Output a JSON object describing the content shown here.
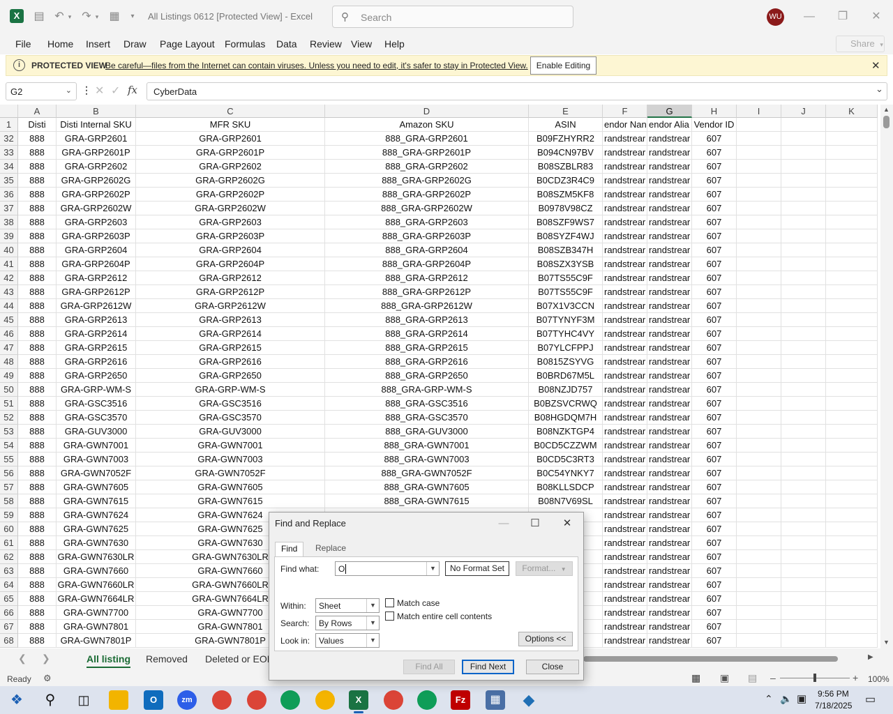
{
  "app": {
    "doc_title": "All Listings 0612  [Protected View]  -  Excel",
    "search_placeholder": "Search",
    "user_initials": "WU"
  },
  "ribbon": {
    "tabs": [
      "File",
      "Home",
      "Insert",
      "Draw",
      "Page Layout",
      "Formulas",
      "Data",
      "Review",
      "View",
      "Help"
    ],
    "share_label": "Share"
  },
  "protected_bar": {
    "title": "PROTECTED VIEW",
    "message": "Be careful—files from the Internet can contain viruses. Unless you need to edit, it's safer to stay in Protected View.",
    "enable_label": "Enable Editing"
  },
  "formula_bar": {
    "name_box": "G2",
    "fx_label": "fx",
    "value": "CyberData"
  },
  "sheet": {
    "columns": [
      "A",
      "B",
      "C",
      "D",
      "E",
      "F",
      "G",
      "H",
      "I",
      "J",
      "K"
    ],
    "selected_column": "G",
    "header_row": {
      "row": "1",
      "cells": [
        "Disti",
        "Disti Internal SKU",
        "MFR SKU",
        "Amazon SKU",
        "ASIN",
        "endor Nan",
        "endor Alia",
        "Vendor ID",
        "",
        "",
        ""
      ]
    },
    "rows": [
      [
        "32",
        "888",
        "GRA-GRP2601",
        "GRA-GRP2601",
        "888_GRA-GRP2601",
        "B09FZHYRR2",
        "randstrear",
        "randstrear",
        "607"
      ],
      [
        "33",
        "888",
        "GRA-GRP2601P",
        "GRA-GRP2601P",
        "888_GRA-GRP2601P",
        "B094CN97BV",
        "randstrear",
        "randstrear",
        "607"
      ],
      [
        "34",
        "888",
        "GRA-GRP2602",
        "GRA-GRP2602",
        "888_GRA-GRP2602",
        "B08SZBLR83",
        "randstrear",
        "randstrear",
        "607"
      ],
      [
        "35",
        "888",
        "GRA-GRP2602G",
        "GRA-GRP2602G",
        "888_GRA-GRP2602G",
        "B0CDZ3R4C9",
        "randstrear",
        "randstrear",
        "607"
      ],
      [
        "36",
        "888",
        "GRA-GRP2602P",
        "GRA-GRP2602P",
        "888_GRA-GRP2602P",
        "B08SZM5KF8",
        "randstrear",
        "randstrear",
        "607"
      ],
      [
        "37",
        "888",
        "GRA-GRP2602W",
        "GRA-GRP2602W",
        "888_GRA-GRP2602W",
        "B0978V98CZ",
        "randstrear",
        "randstrear",
        "607"
      ],
      [
        "38",
        "888",
        "GRA-GRP2603",
        "GRA-GRP2603",
        "888_GRA-GRP2603",
        "B08SZF9WS7",
        "randstrear",
        "randstrear",
        "607"
      ],
      [
        "39",
        "888",
        "GRA-GRP2603P",
        "GRA-GRP2603P",
        "888_GRA-GRP2603P",
        "B08SYZF4WJ",
        "randstrear",
        "randstrear",
        "607"
      ],
      [
        "40",
        "888",
        "GRA-GRP2604",
        "GRA-GRP2604",
        "888_GRA-GRP2604",
        "B08SZB347H",
        "randstrear",
        "randstrear",
        "607"
      ],
      [
        "41",
        "888",
        "GRA-GRP2604P",
        "GRA-GRP2604P",
        "888_GRA-GRP2604P",
        "B08SZX3YSB",
        "randstrear",
        "randstrear",
        "607"
      ],
      [
        "42",
        "888",
        "GRA-GRP2612",
        "GRA-GRP2612",
        "888_GRA-GRP2612",
        "B07TS55C9F",
        "randstrear",
        "randstrear",
        "607"
      ],
      [
        "43",
        "888",
        "GRA-GRP2612P",
        "GRA-GRP2612P",
        "888_GRA-GRP2612P",
        "B07TS55C9F",
        "randstrear",
        "randstrear",
        "607"
      ],
      [
        "44",
        "888",
        "GRA-GRP2612W",
        "GRA-GRP2612W",
        "888_GRA-GRP2612W",
        "B07X1V3CCN",
        "randstrear",
        "randstrear",
        "607"
      ],
      [
        "45",
        "888",
        "GRA-GRP2613",
        "GRA-GRP2613",
        "888_GRA-GRP2613",
        "B07TYNYF3M",
        "randstrear",
        "randstrear",
        "607"
      ],
      [
        "46",
        "888",
        "GRA-GRP2614",
        "GRA-GRP2614",
        "888_GRA-GRP2614",
        "B07TYHC4VY",
        "randstrear",
        "randstrear",
        "607"
      ],
      [
        "47",
        "888",
        "GRA-GRP2615",
        "GRA-GRP2615",
        "888_GRA-GRP2615",
        "B07YLCFPPJ",
        "randstrear",
        "randstrear",
        "607"
      ],
      [
        "48",
        "888",
        "GRA-GRP2616",
        "GRA-GRP2616",
        "888_GRA-GRP2616",
        "B0815ZSYVG",
        "randstrear",
        "randstrear",
        "607"
      ],
      [
        "49",
        "888",
        "GRA-GRP2650",
        "GRA-GRP2650",
        "888_GRA-GRP2650",
        "B0BRD67M5L",
        "randstrear",
        "randstrear",
        "607"
      ],
      [
        "50",
        "888",
        "GRA-GRP-WM-S",
        "GRA-GRP-WM-S",
        "888_GRA-GRP-WM-S",
        "B08NZJD757",
        "randstrear",
        "randstrear",
        "607"
      ],
      [
        "51",
        "888",
        "GRA-GSC3516",
        "GRA-GSC3516",
        "888_GRA-GSC3516",
        "B0BZSVCRWQ",
        "randstrear",
        "randstrear",
        "607"
      ],
      [
        "52",
        "888",
        "GRA-GSC3570",
        "GRA-GSC3570",
        "888_GRA-GSC3570",
        "B08HGDQM7H",
        "randstrear",
        "randstrear",
        "607"
      ],
      [
        "53",
        "888",
        "GRA-GUV3000",
        "GRA-GUV3000",
        "888_GRA-GUV3000",
        "B08NZKTGP4",
        "randstrear",
        "randstrear",
        "607"
      ],
      [
        "54",
        "888",
        "GRA-GWN7001",
        "GRA-GWN7001",
        "888_GRA-GWN7001",
        "B0CD5CZZWM",
        "randstrear",
        "randstrear",
        "607"
      ],
      [
        "55",
        "888",
        "GRA-GWN7003",
        "GRA-GWN7003",
        "888_GRA-GWN7003",
        "B0CD5C3RT3",
        "randstrear",
        "randstrear",
        "607"
      ],
      [
        "56",
        "888",
        "GRA-GWN7052F",
        "GRA-GWN7052F",
        "888_GRA-GWN7052F",
        "B0C54YNKY7",
        "randstrear",
        "randstrear",
        "607"
      ],
      [
        "57",
        "888",
        "GRA-GWN7605",
        "GRA-GWN7605",
        "888_GRA-GWN7605",
        "B08KLLSDCP",
        "randstrear",
        "randstrear",
        "607"
      ],
      [
        "58",
        "888",
        "GRA-GWN7615",
        "GRA-GWN7615",
        "888_GRA-GWN7615",
        "B08N7V69SL",
        "randstrear",
        "randstrear",
        "607"
      ],
      [
        "59",
        "888",
        "GRA-GWN7624",
        "GRA-GWN7624",
        "",
        "7H",
        "randstrear",
        "randstrear",
        "607"
      ],
      [
        "60",
        "888",
        "GRA-GWN7625",
        "GRA-GWN7625",
        "",
        "FR",
        "randstrear",
        "randstrear",
        "607"
      ],
      [
        "61",
        "888",
        "GRA-GWN7630",
        "GRA-GWN7630",
        "",
        "KH",
        "randstrear",
        "randstrear",
        "607"
      ],
      [
        "62",
        "888",
        "GRA-GWN7630LR",
        "GRA-GWN7630LR",
        "",
        "2C",
        "randstrear",
        "randstrear",
        "607"
      ],
      [
        "63",
        "888",
        "GRA-GWN7660",
        "GRA-GWN7660",
        "",
        "3Q",
        "randstrear",
        "randstrear",
        "607"
      ],
      [
        "64",
        "888",
        "GRA-GWN7660LR",
        "GRA-GWN7660LR",
        "",
        "K2",
        "randstrear",
        "randstrear",
        "607"
      ],
      [
        "65",
        "888",
        "GRA-GWN7664LR",
        "GRA-GWN7664LR",
        "",
        "WD",
        "randstrear",
        "randstrear",
        "607"
      ],
      [
        "66",
        "888",
        "GRA-GWN7700",
        "GRA-GWN7700",
        "",
        "3N",
        "randstrear",
        "randstrear",
        "607"
      ],
      [
        "67",
        "888",
        "GRA-GWN7801",
        "GRA-GWN7801",
        "",
        "W5",
        "randstrear",
        "randstrear",
        "607"
      ],
      [
        "68",
        "888",
        "GRA-GWN7801P",
        "GRA-GWN7801P",
        "",
        "T6",
        "randstrear",
        "randstrear",
        "607"
      ]
    ]
  },
  "sheet_tabs": [
    "All listing",
    "Removed",
    "Deleted or EOL"
  ],
  "status": {
    "ready": "Ready",
    "zoom": "100%"
  },
  "dialog": {
    "title": "Find and Replace",
    "tab_find": "Find",
    "tab_replace": "Replace",
    "find_label": "Find what:",
    "find_value": "O",
    "no_format": "No Format Set",
    "format_label": "Format...",
    "within_label": "Within:",
    "within_value": "Sheet",
    "search_label": "Search:",
    "search_value": "By Rows",
    "lookin_label": "Look in:",
    "lookin_value": "Values",
    "match_case": "Match case",
    "match_entire": "Match entire cell contents",
    "options_label": "Options <<",
    "find_all": "Find All",
    "find_next": "Find Next",
    "close": "Close"
  },
  "taskbar": {
    "time": "9:56 PM",
    "date": "7/18/2025"
  },
  "colors": {
    "excel_green": "#1a6b34",
    "protected_bg": "#fdf6d3",
    "avatar": "#8b1a1a"
  }
}
